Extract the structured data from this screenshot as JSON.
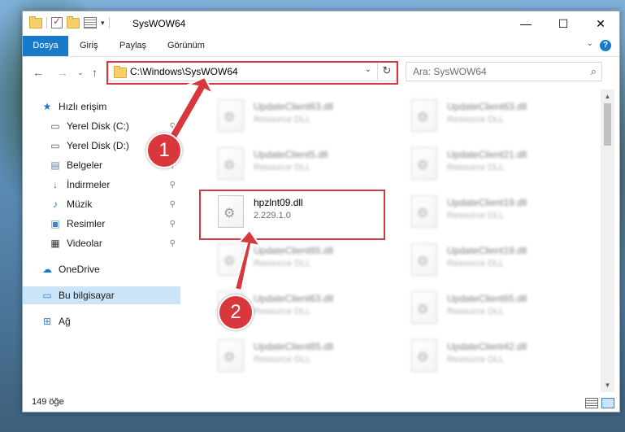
{
  "window": {
    "title": "SysWOW64",
    "controls": {
      "minimize": "—",
      "maximize": "☐",
      "close": "✕"
    }
  },
  "ribbon": {
    "tabs": [
      "Dosya",
      "Giriş",
      "Paylaş",
      "Görünüm"
    ],
    "help": "?"
  },
  "address": {
    "path": "C:\\Windows\\SysWOW64",
    "search_placeholder": "Ara: SysWOW64"
  },
  "nav_pane": {
    "items": [
      {
        "label": "Hızlı erişim",
        "icon": "star-icon"
      },
      {
        "label": "Yerel Disk (C:)",
        "icon": "drive-icon",
        "pinned": true
      },
      {
        "label": "Yerel Disk (D:)",
        "icon": "drive-icon",
        "pinned": true
      },
      {
        "label": "Belgeler",
        "icon": "documents-icon",
        "pinned": true
      },
      {
        "label": "İndirmeler",
        "icon": "download-icon",
        "pinned": true
      },
      {
        "label": "Müzik",
        "icon": "music-icon",
        "pinned": true
      },
      {
        "label": "Resimler",
        "icon": "pictures-icon",
        "pinned": true
      },
      {
        "label": "Videolar",
        "icon": "videos-icon",
        "pinned": true
      },
      {
        "label": "OneDrive",
        "icon": "cloud-icon"
      },
      {
        "label": "Bu bilgisayar",
        "icon": "computer-icon",
        "selected": true
      },
      {
        "label": "Ağ",
        "icon": "network-icon"
      }
    ]
  },
  "files": [
    {
      "name": "UpdateClient63.dll",
      "desc": "Resource DLL",
      "blurred": true
    },
    {
      "name": "UpdateClient63.dll",
      "desc": "Resource DLL",
      "blurred": true
    },
    {
      "name": "UpdateClient5.dll",
      "desc": "Resource DLL",
      "blurred": true
    },
    {
      "name": "UpdateClient21.dll",
      "desc": "Resource DLL",
      "blurred": true
    },
    {
      "name": "hpzlnt09.dll",
      "desc": "2.229.1.0",
      "blurred": false
    },
    {
      "name": "UpdateClient19.dll",
      "desc": "Resource DLL",
      "blurred": true
    },
    {
      "name": "UpdateClient65.dll",
      "desc": "Resource DLL",
      "blurred": true
    },
    {
      "name": "UpdateClient19.dll",
      "desc": "Resource DLL",
      "blurred": true
    },
    {
      "name": "UpdateClient63.dll",
      "desc": "Resource DLL",
      "blurred": true
    },
    {
      "name": "UpdateClient65.dll",
      "desc": "Resource DLL",
      "blurred": true
    },
    {
      "name": "UpdateClient65.dll",
      "desc": "Resource DLL",
      "blurred": true
    },
    {
      "name": "UpdateClient42.dll",
      "desc": "Resource DLL",
      "blurred": true
    }
  ],
  "status": {
    "count": "149 öğe"
  },
  "callouts": [
    "1",
    "2"
  ],
  "colors": {
    "accent": "#1979ca",
    "highlight": "#d8373b",
    "selected": "#cce4f7"
  }
}
